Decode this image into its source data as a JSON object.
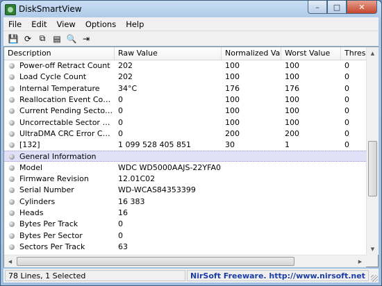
{
  "window": {
    "title": "DiskSmartView",
    "minimize": "–",
    "maximize": "□",
    "close": "✕"
  },
  "menu": [
    "File",
    "Edit",
    "View",
    "Options",
    "Help"
  ],
  "toolbar": [
    {
      "name": "save-icon",
      "glyph": "💾"
    },
    {
      "name": "refresh-icon",
      "glyph": "⟳"
    },
    {
      "name": "copy-icon",
      "glyph": "⧉"
    },
    {
      "name": "properties-icon",
      "glyph": "▤"
    },
    {
      "name": "find-icon",
      "glyph": "🔍"
    },
    {
      "name": "exit-icon",
      "glyph": "⇥"
    }
  ],
  "columns": [
    "Description",
    "Raw Value",
    "Normalized Va...",
    "Worst Value",
    "Thresho..."
  ],
  "rows": [
    {
      "desc": "Power-off Retract Count",
      "raw": "202",
      "norm": "100",
      "worst": "100",
      "thresh": "0"
    },
    {
      "desc": "Load Cycle Count",
      "raw": "202",
      "norm": "100",
      "worst": "100",
      "thresh": "0"
    },
    {
      "desc": "Internal Temperature",
      "raw": "34°C",
      "norm": "176",
      "worst": "176",
      "thresh": "0"
    },
    {
      "desc": "Reallocation Event Count",
      "raw": "0",
      "norm": "100",
      "worst": "100",
      "thresh": "0"
    },
    {
      "desc": "Current Pending Sector Co...",
      "raw": "0",
      "norm": "100",
      "worst": "100",
      "thresh": "0"
    },
    {
      "desc": "Uncorrectable Sector Count",
      "raw": "0",
      "norm": "100",
      "worst": "100",
      "thresh": "0"
    },
    {
      "desc": "UltraDMA CRC Error Count",
      "raw": "0",
      "norm": "200",
      "worst": "200",
      "thresh": "0"
    },
    {
      "desc": "[132]",
      "raw": "1 099 528 405 851",
      "norm": "30",
      "worst": "1",
      "thresh": "0"
    },
    {
      "desc": "General Information",
      "raw": "",
      "norm": "",
      "worst": "",
      "thresh": "",
      "selected": true
    },
    {
      "desc": "Model",
      "raw": "WDC WD5000AAJS-22YFA0",
      "norm": "",
      "worst": "",
      "thresh": ""
    },
    {
      "desc": "Firmware Revision",
      "raw": "12.01C02",
      "norm": "",
      "worst": "",
      "thresh": ""
    },
    {
      "desc": "Serial Number",
      "raw": "WD-WCAS84353399",
      "norm": "",
      "worst": "",
      "thresh": ""
    },
    {
      "desc": "Cylinders",
      "raw": "16 383",
      "norm": "",
      "worst": "",
      "thresh": ""
    },
    {
      "desc": "Heads",
      "raw": "16",
      "norm": "",
      "worst": "",
      "thresh": ""
    },
    {
      "desc": "Bytes Per Track",
      "raw": "0",
      "norm": "",
      "worst": "",
      "thresh": ""
    },
    {
      "desc": "Bytes Per Sector",
      "raw": "0",
      "norm": "",
      "worst": "",
      "thresh": ""
    },
    {
      "desc": "Sectors Per Track",
      "raw": "63",
      "norm": "",
      "worst": "",
      "thresh": ""
    }
  ],
  "status": {
    "left": "78 Lines, 1 Selected",
    "right": "NirSoft Freeware.  http://www.nirsoft.net"
  }
}
